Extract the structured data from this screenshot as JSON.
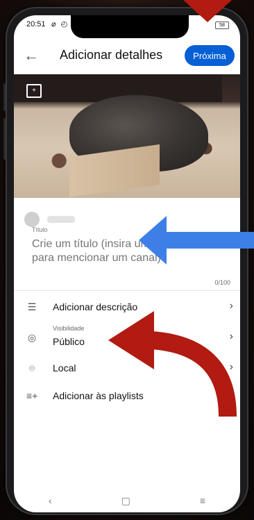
{
  "status": {
    "time": "20:51",
    "battery": "58"
  },
  "appbar": {
    "title": "Adicionar detalhes",
    "next_label": "Próxima"
  },
  "details": {
    "title_label": "Título",
    "title_placeholder": "Crie um título (insira uma @ para mencionar um canal)",
    "counter": "0/100"
  },
  "menu": [
    {
      "icon": "description-icon",
      "label": "Adicionar descrição",
      "sublabel": ""
    },
    {
      "icon": "globe-icon",
      "label": "Público",
      "sublabel": "Visibilidade"
    },
    {
      "icon": "location-pin-icon",
      "label": "Local",
      "sublabel": ""
    },
    {
      "icon": "playlist-add-icon",
      "label": "Adicionar às playlists",
      "sublabel": ""
    }
  ],
  "colors": {
    "accent": "#065fd4",
    "annotation_blue": "#3d7fe6",
    "annotation_red": "#b11b12"
  }
}
